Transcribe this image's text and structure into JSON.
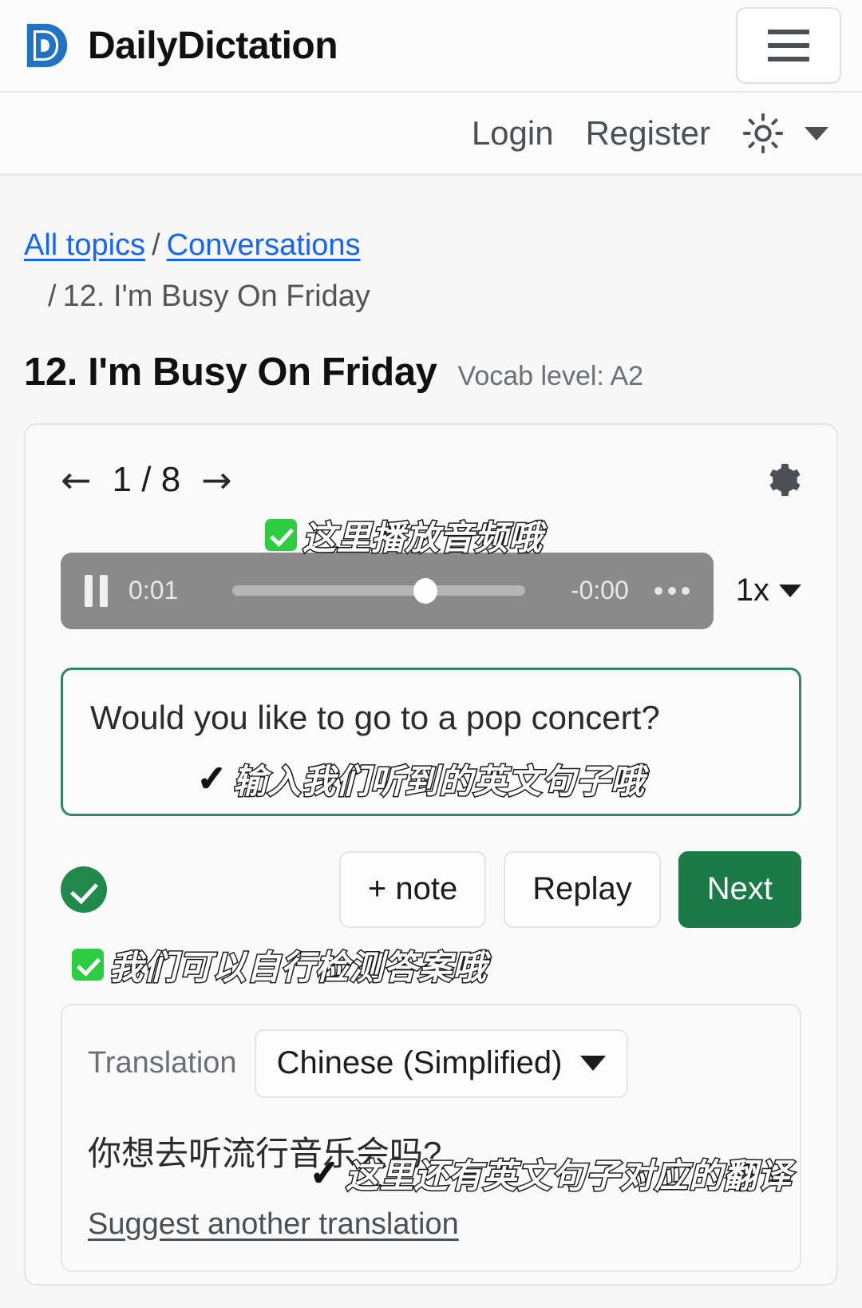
{
  "header": {
    "brand": "DailyDictation",
    "logo_icon": "dailydictation-logo-icon",
    "logo_color": "#2272c4",
    "menu_icon": "hamburger-menu-icon"
  },
  "nav": {
    "login": "Login",
    "register": "Register",
    "theme_icon": "sun-icon",
    "theme_caret_icon": "chevron-down-icon"
  },
  "breadcrumb": {
    "all_topics": "All topics",
    "sep1": "/",
    "conversations": "Conversations",
    "sep2": "/",
    "current": "12. I'm Busy On Friday"
  },
  "page": {
    "title": "12. I'm Busy On Friday",
    "vocab_level": "Vocab level: A2"
  },
  "exercise": {
    "prev_icon": "arrow-left-icon",
    "next_icon": "arrow-right-icon",
    "counter": "1 / 8",
    "settings_icon": "gear-icon"
  },
  "player": {
    "pause_icon": "pause-icon",
    "elapsed": "0:01",
    "remaining": "-0:00",
    "more_icon": "more-options-icon",
    "progress_percent": 66,
    "speed": "1x",
    "speed_caret_icon": "chevron-down-icon"
  },
  "answer": {
    "text": "Would you like to go to a pop concert?",
    "border_color": "#2d8a5c"
  },
  "actions": {
    "check_icon": "check-circle-icon",
    "note": "+ note",
    "replay": "Replay",
    "next": "Next",
    "next_color": "#1b7a47"
  },
  "translation": {
    "label": "Translation",
    "language": "Chinese (Simplified)",
    "caret_icon": "chevron-down-icon",
    "text": "你想去听流行音乐会吗?",
    "suggest": "Suggest another translation"
  },
  "annotations": {
    "audio": "这里播放音频哦",
    "input": "输入我们听到的英文句子哦",
    "selfcheck": "我们可以自行检测答案哦",
    "translation": "这里还有英文句子对应的翻译",
    "check_badge_color": "#2ecc40",
    "tick_glyph": "✓"
  }
}
